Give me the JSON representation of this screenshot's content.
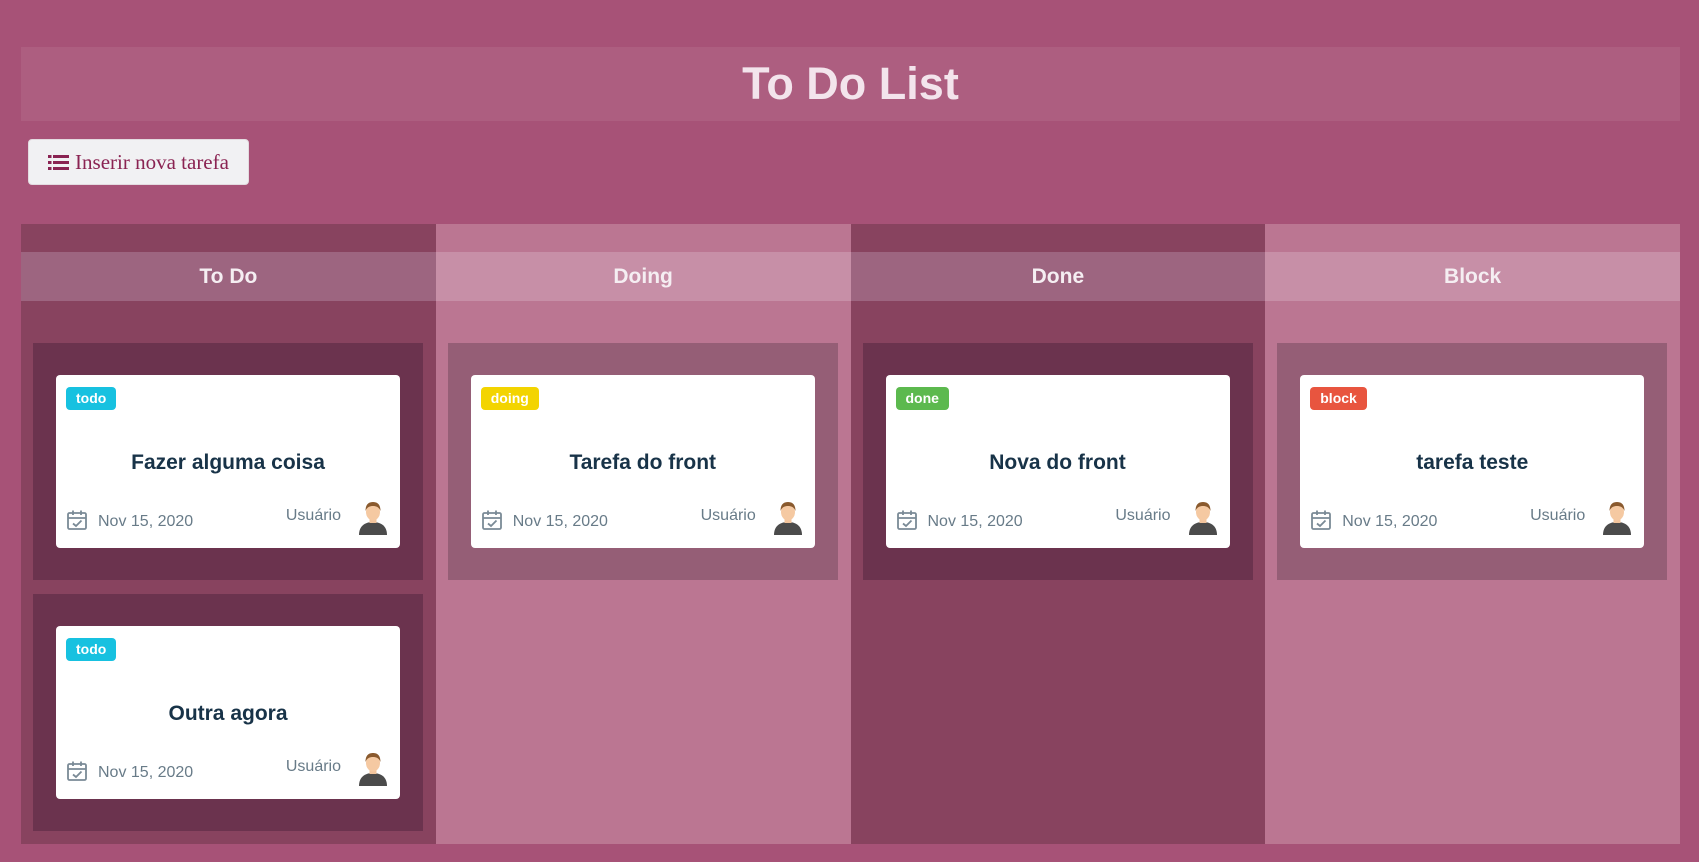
{
  "header": {
    "title": "To Do List"
  },
  "toolbar": {
    "add_task_label": "Inserir nova tarefa"
  },
  "colors": {
    "background": "#a75277",
    "badge_todo": "#17c1e0",
    "badge_doing": "#f3d400",
    "badge_done": "#5cb94e",
    "badge_block": "#e8553f"
  },
  "columns": [
    {
      "title": "To Do",
      "cards": [
        {
          "badge": "todo",
          "title": "Fazer alguma coisa",
          "date": "Nov 15, 2020",
          "user": "Usuário"
        },
        {
          "badge": "todo",
          "title": "Outra agora",
          "date": "Nov 15, 2020",
          "user": "Usuário"
        }
      ]
    },
    {
      "title": "Doing",
      "cards": [
        {
          "badge": "doing",
          "title": "Tarefa do front",
          "date": "Nov 15, 2020",
          "user": "Usuário"
        }
      ]
    },
    {
      "title": "Done",
      "cards": [
        {
          "badge": "done",
          "title": "Nova do front",
          "date": "Nov 15, 2020",
          "user": "Usuário"
        }
      ]
    },
    {
      "title": "Block",
      "cards": [
        {
          "badge": "block",
          "title": "tarefa teste",
          "date": "Nov 15, 2020",
          "user": "Usuário"
        }
      ]
    }
  ]
}
